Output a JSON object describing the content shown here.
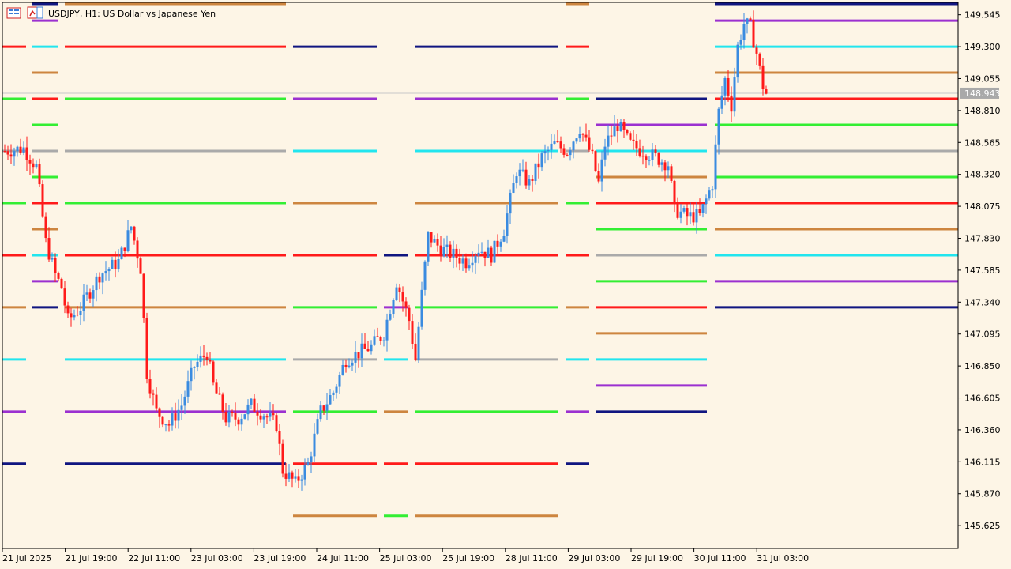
{
  "window": {
    "title": "USDJPY, H1:  US Dollar vs Japanese Yen"
  },
  "colors": {
    "background": "#fdf5e6",
    "bull": "#3a8be0",
    "bear": "#ff1a1a",
    "axis": "#000000",
    "current_price_tag": "#a9a9a9"
  },
  "icons": [
    "window-list-icon",
    "chart-settings-icon"
  ],
  "chart_data": {
    "type": "candlestick",
    "symbol": "USDJPY",
    "timeframe": "H1",
    "current_price": "148.943",
    "ylim": [
      145.45,
      149.64
    ],
    "y_ticks": [
      "149.545",
      "149.300",
      "149.055",
      "148.810",
      "148.565",
      "148.320",
      "148.075",
      "147.830",
      "147.585",
      "147.340",
      "147.095",
      "146.850",
      "146.605",
      "146.360",
      "146.115",
      "145.870",
      "145.625"
    ],
    "x_ticks": [
      "21 Jul 2025",
      "21 Jul 19:00",
      "22 Jul 11:00",
      "23 Jul 03:00",
      "23 Jul 19:00",
      "24 Jul 11:00",
      "25 Jul 03:00",
      "25 Jul 19:00",
      "28 Jul 11:00",
      "29 Jul 03:00",
      "29 Jul 19:00",
      "30 Jul 11:00",
      "31 Jul 03:00"
    ],
    "waypoints": [
      [
        0,
        148.5
      ],
      [
        6,
        148.52
      ],
      [
        10,
        148.38
      ],
      [
        13,
        147.8
      ],
      [
        16,
        147.55
      ],
      [
        18,
        147.45
      ],
      [
        20,
        147.2
      ],
      [
        24,
        147.3
      ],
      [
        30,
        147.55
      ],
      [
        36,
        147.65
      ],
      [
        40,
        147.92
      ],
      [
        43,
        147.6
      ],
      [
        45,
        146.8
      ],
      [
        48,
        146.5
      ],
      [
        52,
        146.4
      ],
      [
        56,
        146.55
      ],
      [
        60,
        146.85
      ],
      [
        64,
        146.95
      ],
      [
        66,
        146.7
      ],
      [
        70,
        146.45
      ],
      [
        74,
        146.45
      ],
      [
        78,
        146.55
      ],
      [
        82,
        146.48
      ],
      [
        86,
        146.4
      ],
      [
        88,
        146.05
      ],
      [
        92,
        145.95
      ],
      [
        96,
        146.1
      ],
      [
        100,
        146.5
      ],
      [
        104,
        146.65
      ],
      [
        108,
        146.9
      ],
      [
        112,
        146.95
      ],
      [
        116,
        147.0
      ],
      [
        120,
        147.1
      ],
      [
        124,
        147.5
      ],
      [
        128,
        147.2
      ],
      [
        130,
        146.9
      ],
      [
        132,
        147.4
      ],
      [
        134,
        147.85
      ],
      [
        138,
        147.75
      ],
      [
        142,
        147.7
      ],
      [
        146,
        147.65
      ],
      [
        150,
        147.75
      ],
      [
        154,
        147.7
      ],
      [
        158,
        147.9
      ],
      [
        162,
        148.35
      ],
      [
        166,
        148.25
      ],
      [
        170,
        148.45
      ],
      [
        174,
        148.55
      ],
      [
        178,
        148.5
      ],
      [
        182,
        148.68
      ],
      [
        186,
        148.45
      ],
      [
        188,
        148.25
      ],
      [
        190,
        148.55
      ],
      [
        194,
        148.7
      ],
      [
        198,
        148.55
      ],
      [
        202,
        148.5
      ],
      [
        206,
        148.45
      ],
      [
        210,
        148.4
      ],
      [
        212,
        148.05
      ],
      [
        216,
        148.0
      ],
      [
        220,
        148.0
      ],
      [
        224,
        148.25
      ],
      [
        226,
        148.8
      ],
      [
        228,
        149.05
      ],
      [
        230,
        148.85
      ],
      [
        232,
        149.3
      ],
      [
        234,
        149.48
      ],
      [
        236,
        149.45
      ],
      [
        238,
        149.25
      ],
      [
        240,
        149.0
      ],
      [
        241,
        148.94
      ]
    ],
    "level_groups": [
      {
        "x0": 3,
        "x1": 33,
        "levels": [
          [
            149.3,
            "#ff1a1a"
          ],
          [
            148.9,
            "#33ee33"
          ],
          [
            148.5,
            "#aaaaaa"
          ],
          [
            148.1,
            "#33ee33"
          ],
          [
            147.7,
            "#ff1a1a"
          ],
          [
            147.3,
            "#cd853f"
          ],
          [
            146.9,
            "#22e5ee"
          ],
          [
            146.5,
            "#9b30d0"
          ],
          [
            146.1,
            "#101580"
          ]
        ]
      },
      {
        "x0": 41,
        "x1": 73,
        "levels": [
          [
            149.69,
            "#101580"
          ],
          [
            149.5,
            "#9b30d0"
          ],
          [
            149.3,
            "#22e5ee"
          ],
          [
            149.1,
            "#cd853f"
          ],
          [
            148.9,
            "#ff1a1a"
          ],
          [
            148.7,
            "#33ee33"
          ],
          [
            148.5,
            "#aaaaaa"
          ],
          [
            148.3,
            "#33ee33"
          ],
          [
            148.1,
            "#ff1a1a"
          ],
          [
            147.9,
            "#cd853f"
          ],
          [
            147.7,
            "#22e5ee"
          ],
          [
            147.5,
            "#9b30d0"
          ],
          [
            147.3,
            "#101580"
          ]
        ]
      },
      {
        "x0": 82,
        "x1": 362,
        "levels": [
          [
            149.69,
            "#cd853f"
          ],
          [
            149.3,
            "#ff1a1a"
          ],
          [
            148.9,
            "#33ee33"
          ],
          [
            148.5,
            "#aaaaaa"
          ],
          [
            148.1,
            "#33ee33"
          ],
          [
            147.7,
            "#ff1a1a"
          ],
          [
            147.3,
            "#cd853f"
          ],
          [
            146.9,
            "#22e5ee"
          ],
          [
            146.5,
            "#9b30d0"
          ],
          [
            146.1,
            "#101580"
          ]
        ]
      },
      {
        "x0": 371,
        "x1": 477,
        "levels": [
          [
            149.3,
            "#101580"
          ],
          [
            148.9,
            "#9b30d0"
          ],
          [
            148.5,
            "#22e5ee"
          ],
          [
            148.1,
            "#cd853f"
          ],
          [
            147.7,
            "#ff1a1a"
          ],
          [
            147.3,
            "#33ee33"
          ],
          [
            146.9,
            "#aaaaaa"
          ],
          [
            146.5,
            "#33ee33"
          ],
          [
            146.1,
            "#ff1a1a"
          ],
          [
            145.7,
            "#cd853f"
          ]
        ]
      },
      {
        "x0": 486,
        "x1": 517,
        "levels": [
          [
            147.7,
            "#101580"
          ],
          [
            147.3,
            "#9b30d0"
          ],
          [
            146.9,
            "#22e5ee"
          ],
          [
            146.5,
            "#cd853f"
          ],
          [
            146.1,
            "#ff1a1a"
          ],
          [
            145.7,
            "#33ee33"
          ]
        ]
      },
      {
        "x0": 526,
        "x1": 707,
        "levels": [
          [
            149.3,
            "#101580"
          ],
          [
            148.9,
            "#9b30d0"
          ],
          [
            148.5,
            "#22e5ee"
          ],
          [
            148.1,
            "#cd853f"
          ],
          [
            147.7,
            "#ff1a1a"
          ],
          [
            147.3,
            "#33ee33"
          ],
          [
            146.9,
            "#aaaaaa"
          ],
          [
            146.5,
            "#33ee33"
          ],
          [
            146.1,
            "#ff1a1a"
          ],
          [
            145.7,
            "#cd853f"
          ]
        ]
      },
      {
        "x0": 716,
        "x1": 746,
        "levels": [
          [
            149.69,
            "#cd853f"
          ],
          [
            149.3,
            "#ff1a1a"
          ],
          [
            148.9,
            "#33ee33"
          ],
          [
            148.5,
            "#aaaaaa"
          ],
          [
            148.1,
            "#33ee33"
          ],
          [
            147.7,
            "#ff1a1a"
          ],
          [
            147.3,
            "#cd853f"
          ],
          [
            146.9,
            "#22e5ee"
          ],
          [
            146.5,
            "#9b30d0"
          ],
          [
            146.1,
            "#101580"
          ]
        ]
      },
      {
        "x0": 755,
        "x1": 895,
        "levels": [
          [
            148.9,
            "#101580"
          ],
          [
            148.7,
            "#9b30d0"
          ],
          [
            148.5,
            "#22e5ee"
          ],
          [
            148.3,
            "#cd853f"
          ],
          [
            148.1,
            "#ff1a1a"
          ],
          [
            147.9,
            "#33ee33"
          ],
          [
            147.7,
            "#aaaaaa"
          ],
          [
            147.5,
            "#33ee33"
          ],
          [
            147.3,
            "#ff1a1a"
          ],
          [
            147.1,
            "#cd853f"
          ],
          [
            146.9,
            "#22e5ee"
          ],
          [
            146.7,
            "#9b30d0"
          ],
          [
            146.5,
            "#101580"
          ]
        ]
      },
      {
        "x0": 905,
        "x1": 1213,
        "levels": [
          [
            149.7,
            "#101580"
          ],
          [
            149.5,
            "#9b30d0"
          ],
          [
            149.3,
            "#22e5ee"
          ],
          [
            149.1,
            "#cd853f"
          ],
          [
            148.9,
            "#ff1a1a"
          ],
          [
            148.7,
            "#33ee33"
          ],
          [
            148.5,
            "#aaaaaa"
          ],
          [
            148.3,
            "#33ee33"
          ],
          [
            148.1,
            "#ff1a1a"
          ],
          [
            147.9,
            "#cd853f"
          ],
          [
            147.7,
            "#22e5ee"
          ],
          [
            147.5,
            "#9b30d0"
          ],
          [
            147.3,
            "#101580"
          ]
        ]
      }
    ]
  }
}
